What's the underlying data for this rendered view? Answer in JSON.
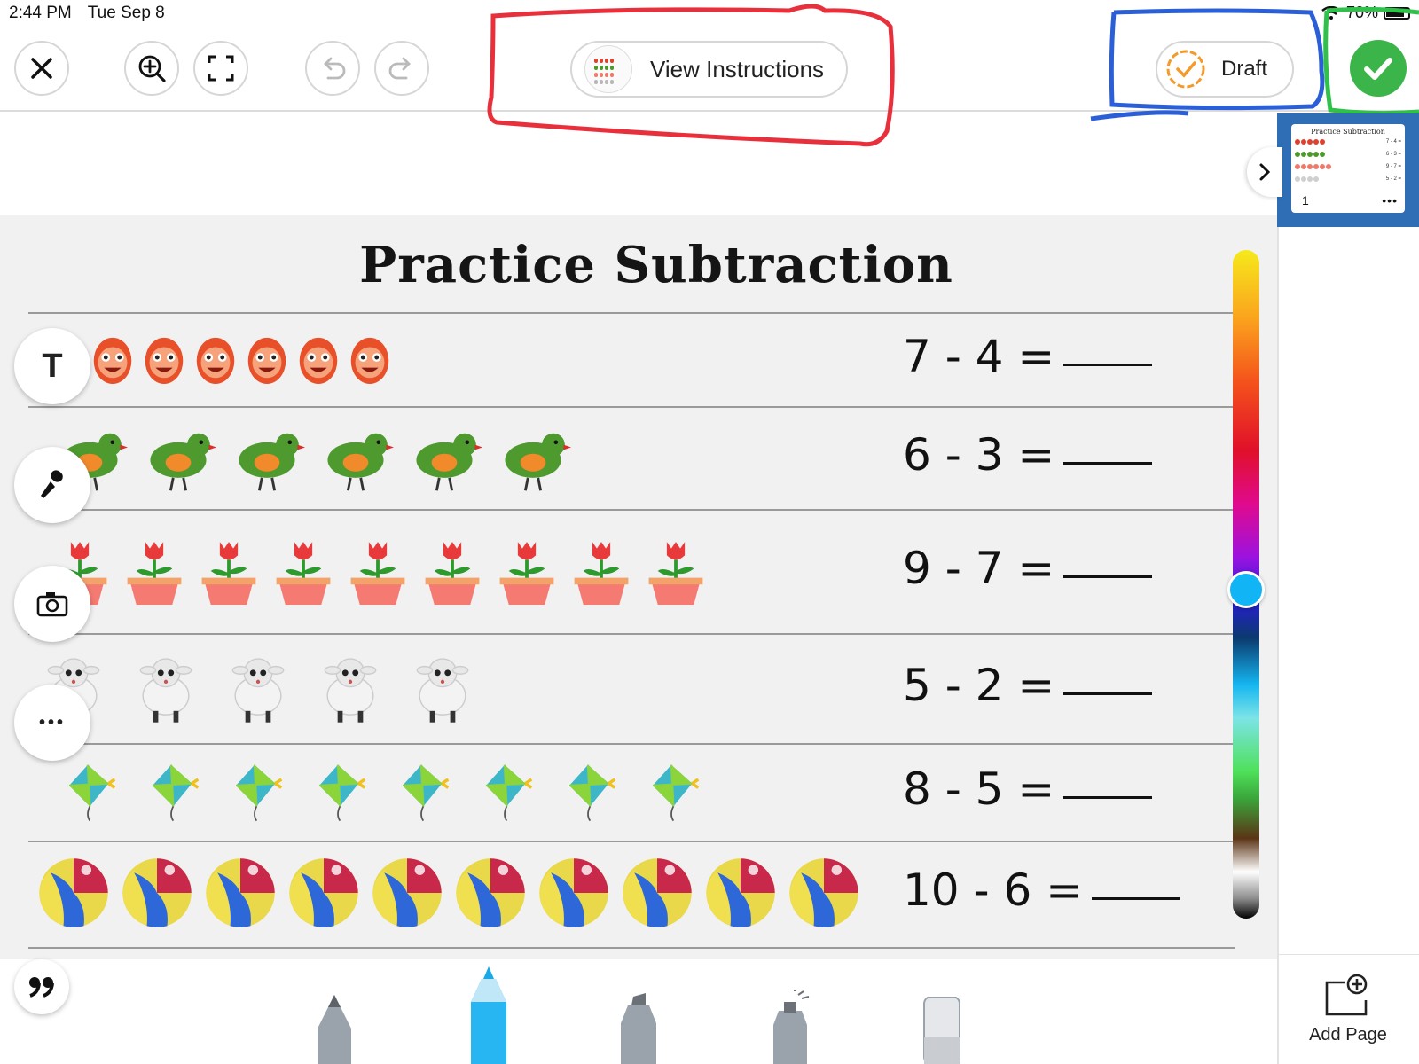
{
  "status": {
    "time": "2:44 PM",
    "date": "Tue Sep 8",
    "battery": "70%"
  },
  "toolbar": {
    "close_icon": "close-icon",
    "zoom_icon": "zoom-in-icon",
    "fullscreen_icon": "fullscreen-icon",
    "undo_icon": "undo-icon",
    "redo_icon": "redo-icon",
    "instructions_label": "View Instructions",
    "draft_label": "Draft",
    "done_icon": "checkmark-icon"
  },
  "worksheet": {
    "title": "Practice Subtraction",
    "rows": [
      {
        "item": "egg-face",
        "count": 7,
        "equation": "7 - 4 ="
      },
      {
        "item": "bird",
        "count": 6,
        "equation": "6 - 3 ="
      },
      {
        "item": "tulip-pot",
        "count": 9,
        "equation": "9 - 7 ="
      },
      {
        "item": "sheep",
        "count": 5,
        "equation": "5 - 2 ="
      },
      {
        "item": "kite",
        "count": 8,
        "equation": "8 - 5 ="
      },
      {
        "item": "beach-ball",
        "count": 10,
        "equation": "10 - 6 ="
      }
    ]
  },
  "side_tools": {
    "text_label": "T",
    "mic_icon": "microphone-icon",
    "camera_icon": "camera-icon",
    "more_label": "•••",
    "quote_icon": "quote-icon"
  },
  "colors": {
    "done_green": "#3bb54a",
    "draft_orange": "#f39a2b",
    "slider_knob": "#11b4f5",
    "panel_blue": "#2f6eb5"
  },
  "thumbnail": {
    "title": "Practice Subtraction",
    "page_number": "1",
    "more": "•••",
    "eq": [
      "7 - 4 =",
      "6 - 3 =",
      "9 - 7 =",
      "5 - 2 ="
    ]
  },
  "right_panel": {
    "add_page_label": "Add Page"
  },
  "drawing_tools": [
    "pencil",
    "marker",
    "highlighter",
    "spray",
    "eraser"
  ]
}
